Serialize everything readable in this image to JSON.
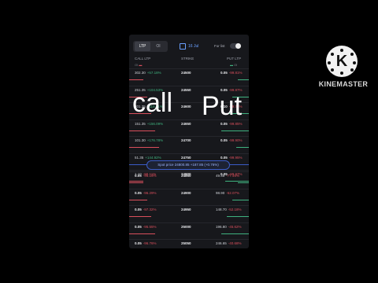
{
  "topbar": {
    "tabs": [
      {
        "label": "LTP"
      },
      {
        "label": "OI"
      }
    ],
    "date": "16 Jul",
    "for_list_label": "For list"
  },
  "headers": {
    "call": "CALL LTP",
    "call_sub": "OI",
    "strike": "STRIKE",
    "put": "PUT LTP",
    "put_sub": "OI"
  },
  "rows_top": [
    {
      "call_ltp": "302.30",
      "call_chg": "+57.18%",
      "strike": "24500",
      "put_ltp": "0.05",
      "put_chg": "-99.81%"
    },
    {
      "call_ltp": "251.35",
      "call_chg": "+104.53%",
      "strike": "24550",
      "put_ltp": "0.05",
      "put_chg": "-99.87%"
    },
    {
      "call_ltp": "201.35",
      "call_chg": "+118.21%",
      "strike": "24600",
      "put_ltp": "0.10",
      "put_chg": "-99.71%"
    },
    {
      "call_ltp": "151.35",
      "call_chg": "+156.09%",
      "strike": "24650",
      "put_ltp": "0.05",
      "put_chg": "-99.85%"
    },
    {
      "call_ltp": "101.30",
      "call_chg": "+176.78%",
      "strike": "24700",
      "put_ltp": "0.05",
      "put_chg": "-99.90%"
    },
    {
      "call_ltp": "51.35",
      "call_chg": "+144.92%",
      "strike": "24750",
      "put_ltp": "0.05",
      "put_chg": "-99.95%"
    },
    {
      "call_ltp": "1.10",
      "call_chg": "-90.11%",
      "strike": "24800",
      "put_ltp": "0.05",
      "put_chg": "-99.97%"
    }
  ],
  "spot": {
    "label": "Spot price 24800.85",
    "change": "+187.85 (+0.76%)"
  },
  "rows_bottom": [
    {
      "call_ltp": "0.05",
      "call_chg": "-95.15%",
      "strike": "24850",
      "put_ltp": "49.55",
      "put_chg": "-77.46%"
    },
    {
      "call_ltp": "0.05",
      "call_chg": "-96.29%",
      "strike": "24900",
      "put_ltp": "98.90",
      "put_chg": "-62.07%"
    },
    {
      "call_ltp": "0.05",
      "call_chg": "-97.32%",
      "strike": "24950",
      "put_ltp": "148.70",
      "put_chg": "-52.18%"
    },
    {
      "call_ltp": "0.05",
      "call_chg": "-95.55%",
      "strike": "25000",
      "put_ltp": "196.80",
      "put_chg": "-45.62%"
    },
    {
      "call_ltp": "0.05",
      "call_chg": "-96.76%",
      "strike": "25050",
      "put_ltp": "246.65",
      "put_chg": "-40.68%"
    },
    {
      "call_ltp": "0.05",
      "call_chg": "-92.31%",
      "strike": "25100",
      "put_ltp": "295.65",
      "put_chg": "-35.66%"
    }
  ],
  "overlay": {
    "call": "call",
    "put": "Put"
  },
  "watermark": {
    "brand": "KINEMASTER",
    "logo_letter": "K"
  },
  "colors": {
    "up": "#3fb27f",
    "down": "#d94f5c",
    "accent": "#3b5cc7"
  }
}
